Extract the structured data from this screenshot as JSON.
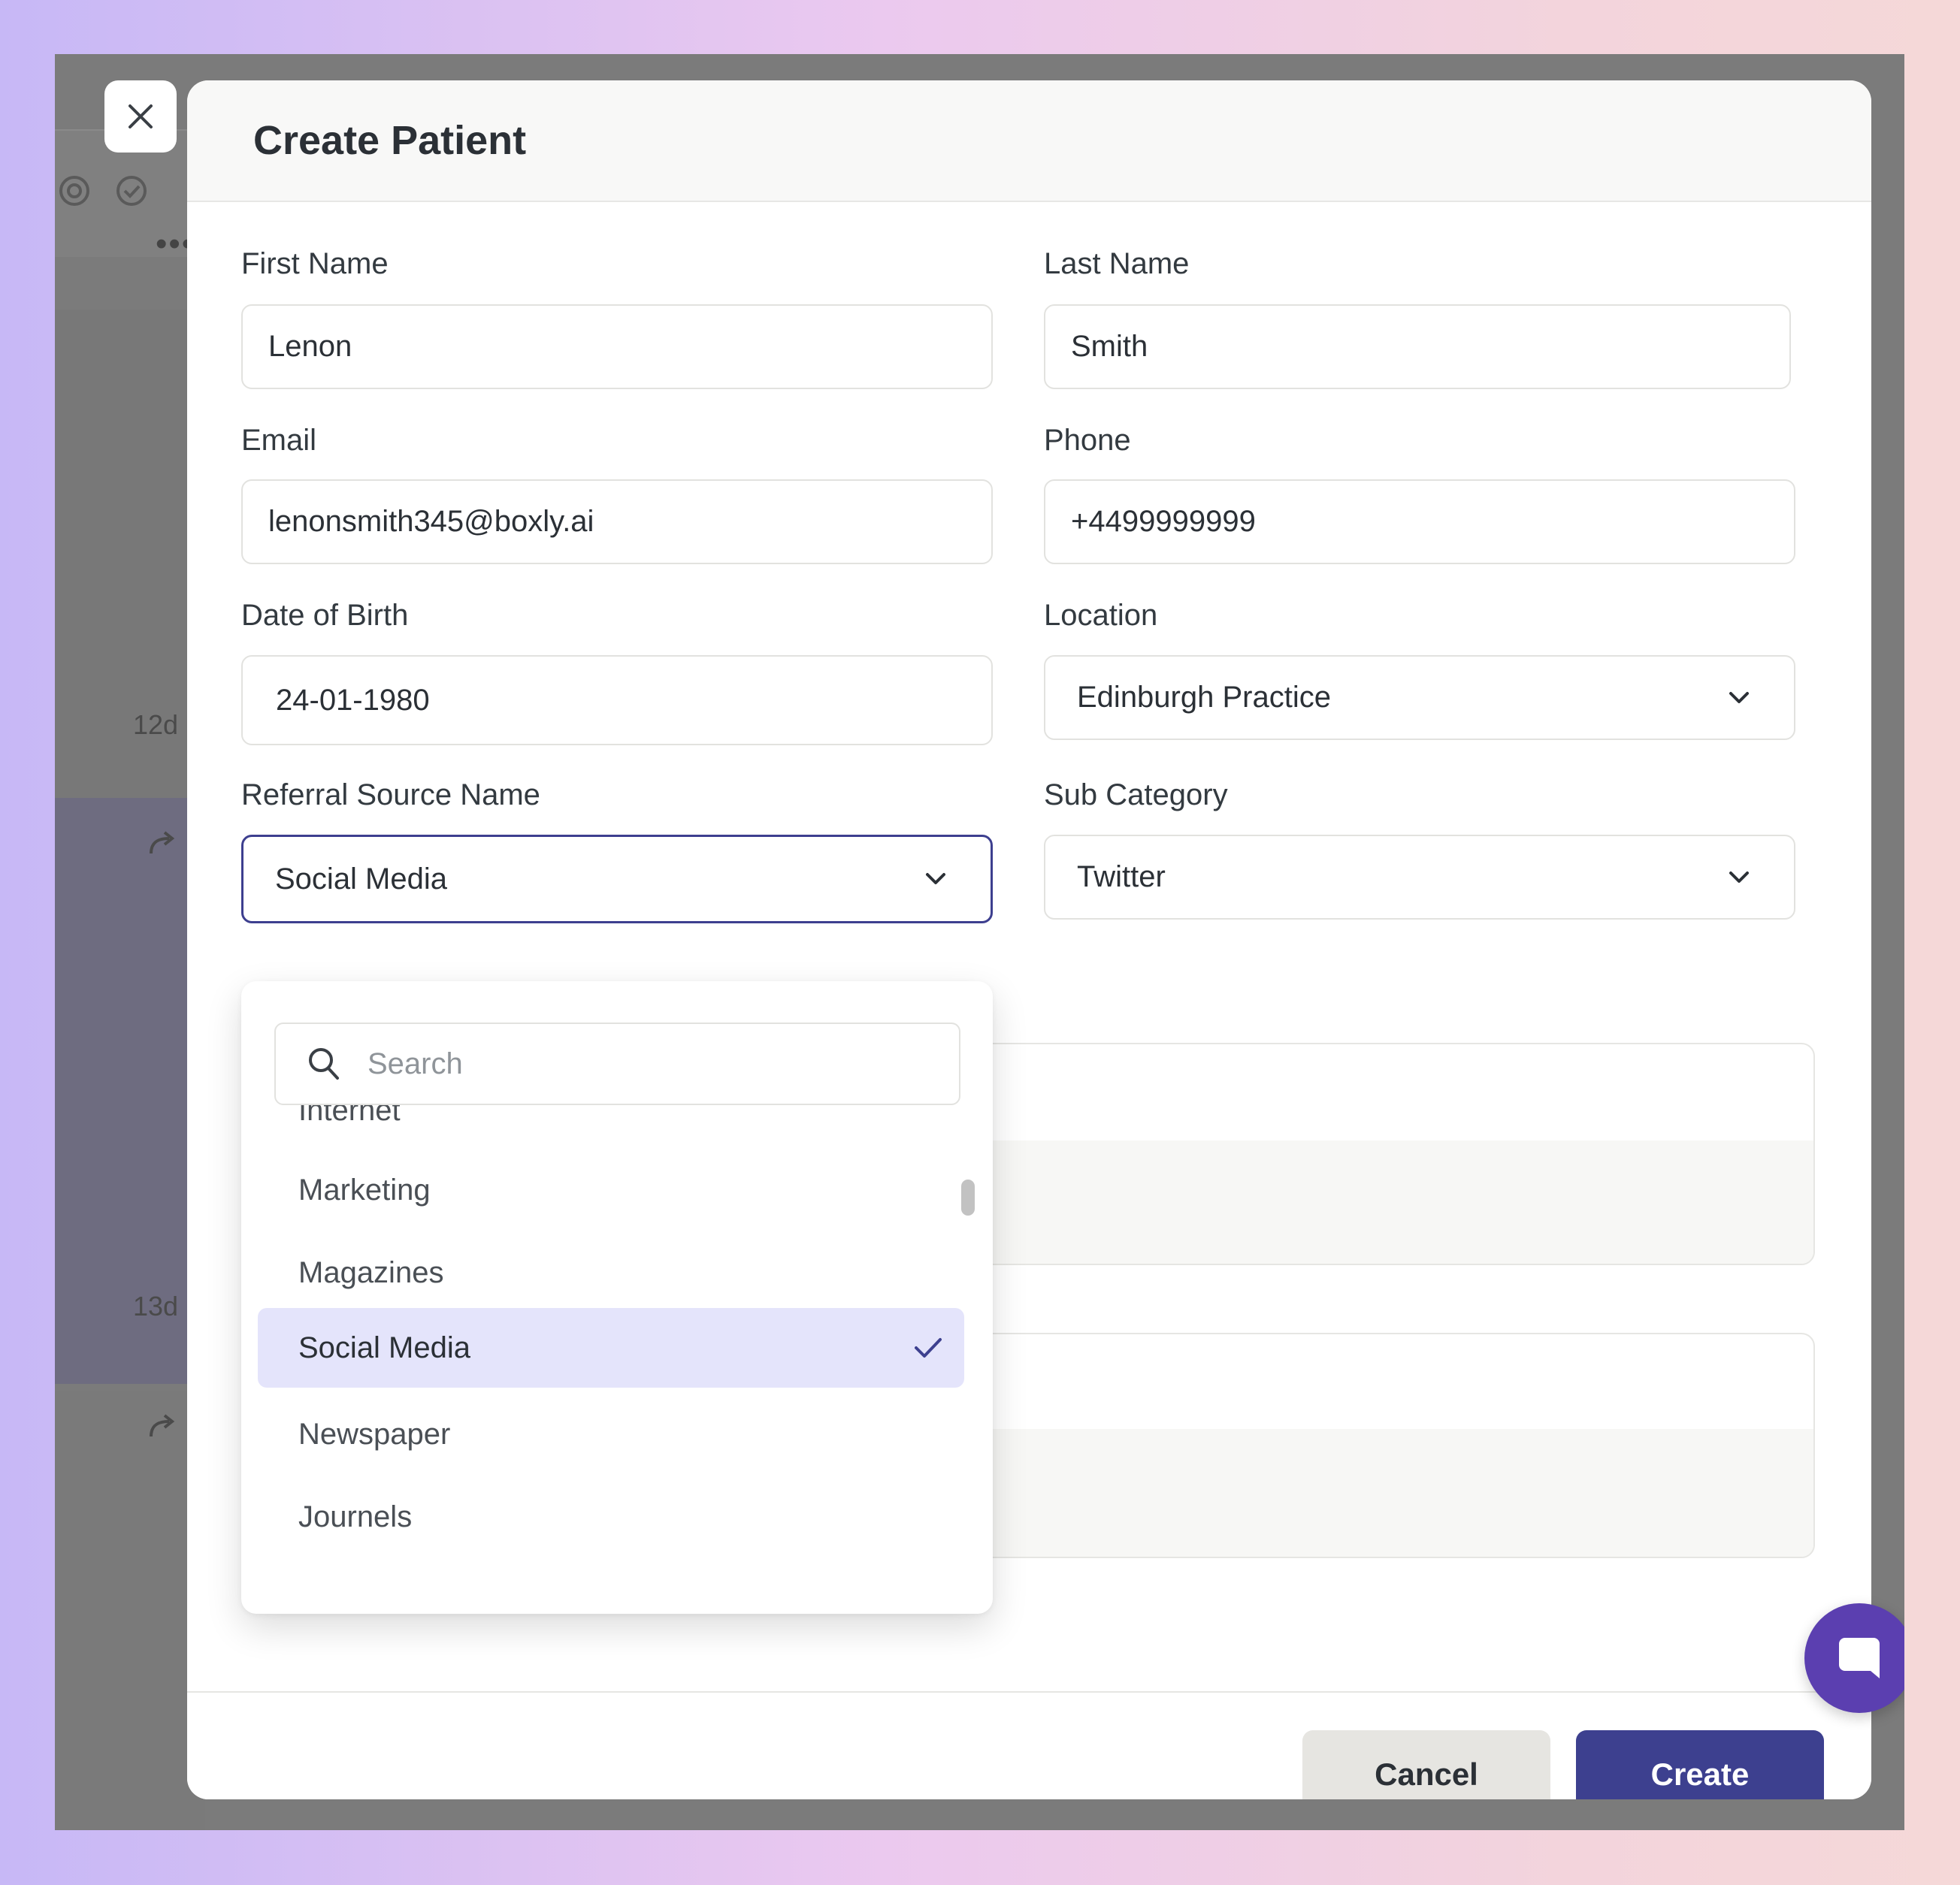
{
  "modal": {
    "title": "Create Patient"
  },
  "background": {
    "row_ages": [
      "12d",
      "13d"
    ]
  },
  "form": {
    "first_name": {
      "label": "First Name",
      "value": "Lenon"
    },
    "last_name": {
      "label": "Last Name",
      "value": "Smith"
    },
    "email": {
      "label": "Email",
      "value": "lenonsmith345@boxly.ai"
    },
    "phone": {
      "label": "Phone",
      "value": "+4499999999"
    },
    "dob": {
      "label": "Date of Birth",
      "value": "24-01-1980"
    },
    "location": {
      "label": "Location",
      "value": "Edinburgh Practice"
    },
    "referral_source": {
      "label": "Referral Source Name",
      "value": "Social Media"
    },
    "sub_category": {
      "label": "Sub Category",
      "value": "Twitter"
    }
  },
  "dropdown": {
    "search_placeholder": "Search",
    "options": [
      "Internet",
      "Marketing",
      "Magazines",
      "Social Media",
      "Newspaper",
      "Journels"
    ],
    "selected": "Social Media"
  },
  "footer": {
    "cancel_label": "Cancel",
    "create_label": "Create"
  },
  "colors": {
    "primary": "#3d408f",
    "selected_option_bg": "#e4e4fb",
    "chat_button": "#5b3fb0"
  }
}
